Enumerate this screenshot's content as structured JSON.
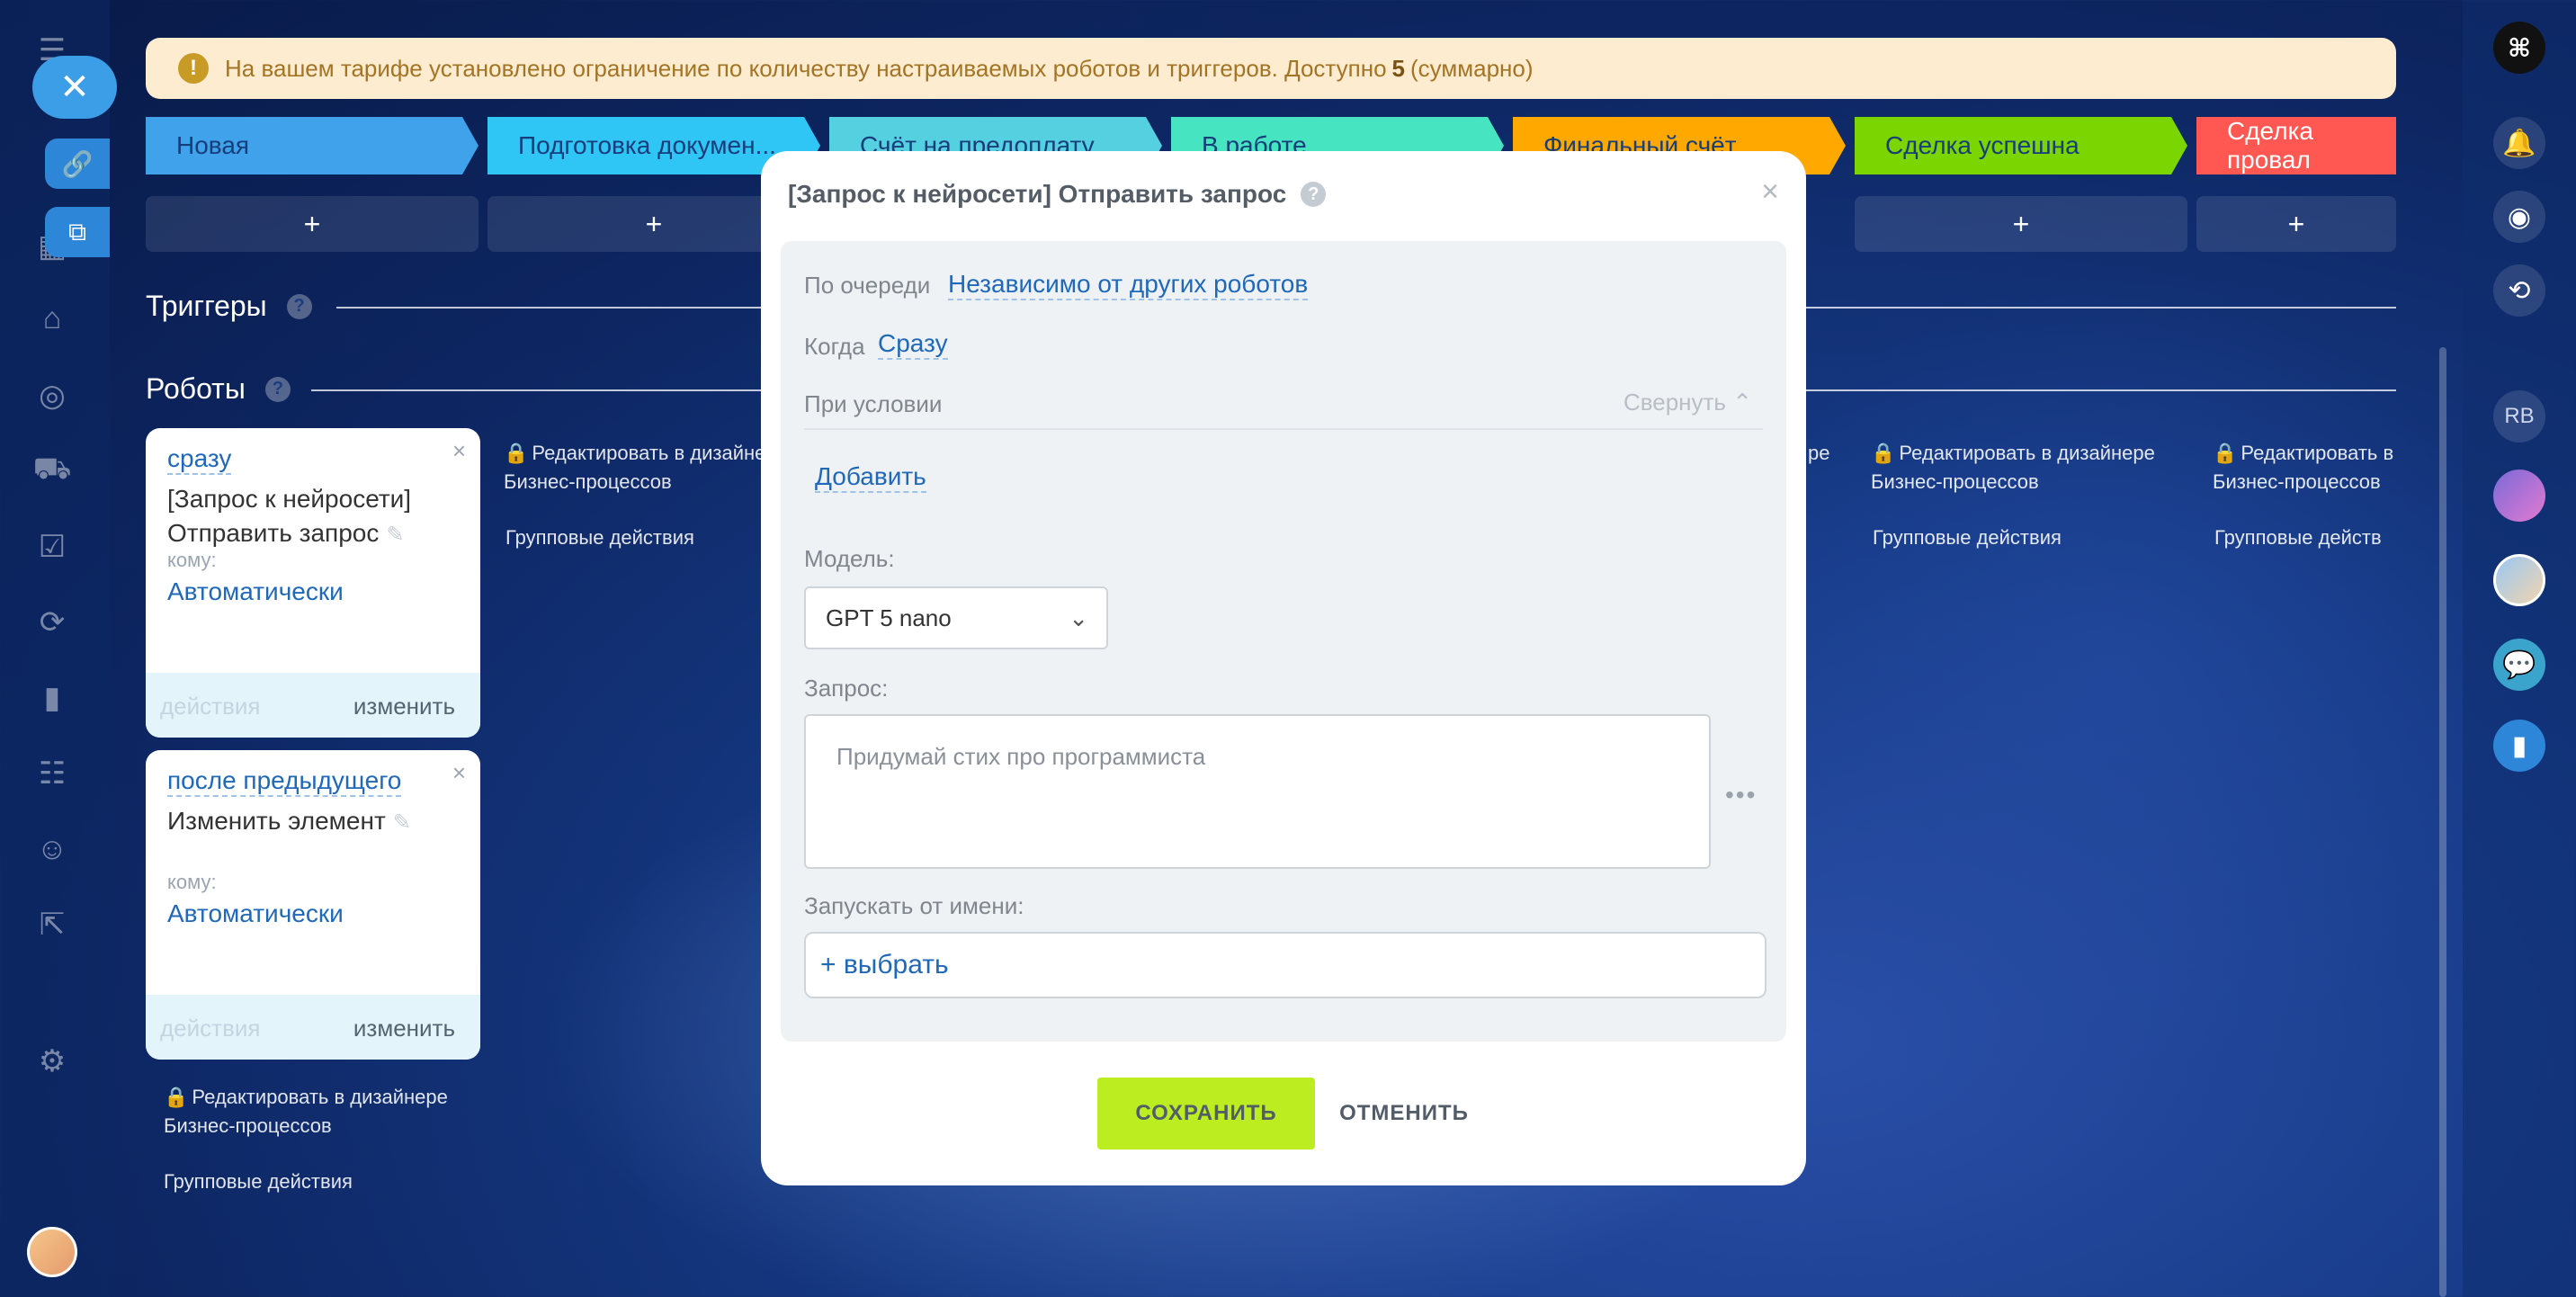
{
  "notice": {
    "text": "На вашем тарифе установлено ограничение по количеству настраиваемых роботов и триггеров. Доступно",
    "count": "5",
    "suffix": "(суммарно)"
  },
  "stages": [
    {
      "label": "Новая",
      "color": "#3fa2ea"
    },
    {
      "label": "Подготовка докумен...",
      "color": "#2fc6f6"
    },
    {
      "label": "Счёт на предоплату",
      "color": "#55d0e0"
    },
    {
      "label": "В работе",
      "color": "#47e4c2"
    },
    {
      "label": "Финальный счёт",
      "color": "#ffa900"
    },
    {
      "label": "Сделка успешна",
      "color": "#7bd500"
    },
    {
      "label": "Сделка провал",
      "color": "#ff5752"
    }
  ],
  "add_symbol": "+",
  "sections": {
    "triggers": "Триггеры",
    "robots": "Роботы"
  },
  "robots": [
    {
      "when": "сразу",
      "title_line1": "[Запрос к нейросети]",
      "title_line2": "Отправить запрос",
      "to_label": "кому:",
      "to_value": "Автоматически",
      "actions": "действия",
      "edit": "изменить"
    },
    {
      "when": "после предыдущего",
      "title_line1": "Изменить элемент",
      "to_label": "кому:",
      "to_value": "Автоматически",
      "actions": "действия",
      "edit": "изменить"
    }
  ],
  "column_links": {
    "edit_designer_1": "Редактировать в дизайнере",
    "edit_designer_2": "Бизнес-процессов",
    "group_actions": "Групповые действия",
    "partial_edit": "Редактировать в",
    "partial_group": "Групповые действ",
    "partial_re": "ре"
  },
  "modal": {
    "title": "[Запрос к нейросети] Отправить запрос",
    "order_label": "По очереди",
    "order_value": "Независимо от других роботов",
    "when_label": "Когда",
    "when_value": "Сразу",
    "condition_label": "При условии",
    "collapse_label": "Свернуть",
    "add_label": "Добавить",
    "model_label": "Модель:",
    "model_value": "GPT 5 nano",
    "request_label": "Запрос:",
    "request_placeholder": "Придумай стих про программиста",
    "run_as_label": "Запускать от имени:",
    "choose_label": "+ выбрать",
    "save": "СОХРАНИТЬ",
    "cancel": "ОТМЕНИТЬ"
  },
  "right_sidebar": {
    "initials": "RB"
  }
}
